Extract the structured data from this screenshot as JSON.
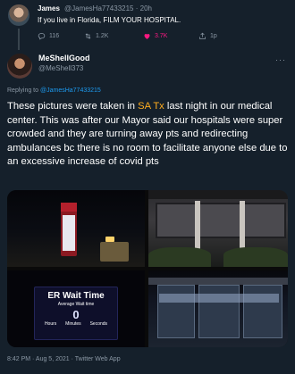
{
  "parent_tweet": {
    "name": "James",
    "handle": "@JamesHa77433215",
    "time": "20h",
    "text": "If you live in Florida, FILM YOUR HOSPITAL.",
    "replies": "116",
    "retweets": "1.2K",
    "likes": "3.7K",
    "share": "1p"
  },
  "tweet": {
    "name": "MeShellGood",
    "handle": "@MeShell373",
    "more_icon": "···",
    "replying_prefix": "Replying to",
    "replying_to": "@JamesHa77433215",
    "text_pre": "These pictures were taken in ",
    "text_highlight": "SA Tx",
    "text_post": " last night in our medical center. This was after our Mayor said our hospitals were super crowded and they are turning away pts and redirecting ambulances bc there is no room to facilitate anyone else due to an excessive increase of covid pts",
    "timestamp": "8:42 PM · Aug 5, 2021 · Twitter Web App"
  },
  "media": {
    "er_sign": {
      "title": "ER Wait Time",
      "subtitle": "Average Wait time",
      "value": "0",
      "hours": "Hours",
      "minutes": "Minutes",
      "seconds": "Seconds"
    }
  },
  "colors": {
    "background": "#15202b",
    "muted": "#8b98a5",
    "link": "#1d9bf0",
    "highlight": "#ffad1f",
    "like": "#f91880"
  }
}
